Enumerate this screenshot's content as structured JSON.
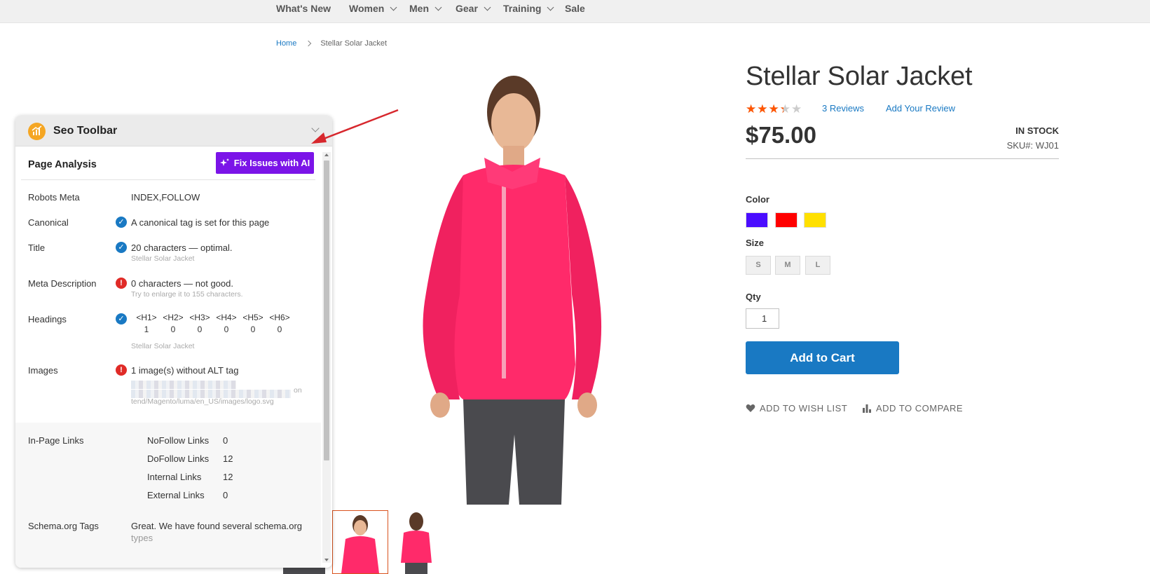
{
  "nav": {
    "items": [
      {
        "label": "What's New",
        "has_caret": false
      },
      {
        "label": "Women",
        "has_caret": true
      },
      {
        "label": "Men",
        "has_caret": true
      },
      {
        "label": "Gear",
        "has_caret": true
      },
      {
        "label": "Training",
        "has_caret": true
      },
      {
        "label": "Sale",
        "has_caret": false
      }
    ]
  },
  "breadcrumb": {
    "home": "Home",
    "current": "Stellar Solar Jacket"
  },
  "product": {
    "title": "Stellar Solar Jacket",
    "rating_stars": "★★★★★",
    "rating_percent": 67,
    "reviews": "3  Reviews",
    "add_review": "Add Your Review",
    "price": "$75.00",
    "stock": "IN STOCK",
    "sku": "SKU#:  WJ01",
    "color_label": "Color",
    "colors": [
      "#4a0dff",
      "#ff0000",
      "#ffe000"
    ],
    "size_label": "Size",
    "sizes": [
      "S",
      "M",
      "L"
    ],
    "qty_label": "Qty",
    "qty_value": "1",
    "add_to_cart": "Add to Cart",
    "wishlist": "ADD TO WISH LIST",
    "compare": "ADD TO COMPARE"
  },
  "seo": {
    "toolbar_title": "Seo Toolbar",
    "page_analysis": "Page Analysis",
    "fix_button": "Fix Issues with AI",
    "robots_label": "Robots Meta",
    "robots_value": "INDEX,FOLLOW",
    "canonical_label": "Canonical",
    "canonical_value": "A canonical tag is set for this page",
    "title_label": "Title",
    "title_value": "20 characters — optimal.",
    "title_sub": "Stellar Solar Jacket",
    "meta_label": "Meta Description",
    "meta_value": "0 characters — not good.",
    "meta_sub": "Try to enlarge it to 155 characters.",
    "headings_label": "Headings",
    "headings": [
      {
        "tag": "<H1>",
        "count": "1"
      },
      {
        "tag": "<H2>",
        "count": "0"
      },
      {
        "tag": "<H3>",
        "count": "0"
      },
      {
        "tag": "<H4>",
        "count": "0"
      },
      {
        "tag": "<H5>",
        "count": "0"
      },
      {
        "tag": "<H6>",
        "count": "0"
      }
    ],
    "headings_sub": "Stellar Solar Jacket",
    "images_label": "Images",
    "images_value": "1 image(s) without ALT tag",
    "images_sub_tail": "on",
    "images_path": "tend/Magento/luma/en_US/images/logo.svg",
    "links_label": "In-Page Links",
    "links": [
      {
        "name": "NoFollow Links",
        "value": "0"
      },
      {
        "name": "DoFollow Links",
        "value": "12"
      },
      {
        "name": "Internal Links",
        "value": "12"
      },
      {
        "name": "External Links",
        "value": "0"
      }
    ],
    "schema_label": "Schema.org Tags",
    "schema_value": "Great. We have found several schema.org",
    "schema_value2": "types"
  },
  "colors": {
    "accent": "#1979c3",
    "ai_button": "#7b14e8",
    "error": "#e02b27",
    "star": "#ff5501"
  }
}
